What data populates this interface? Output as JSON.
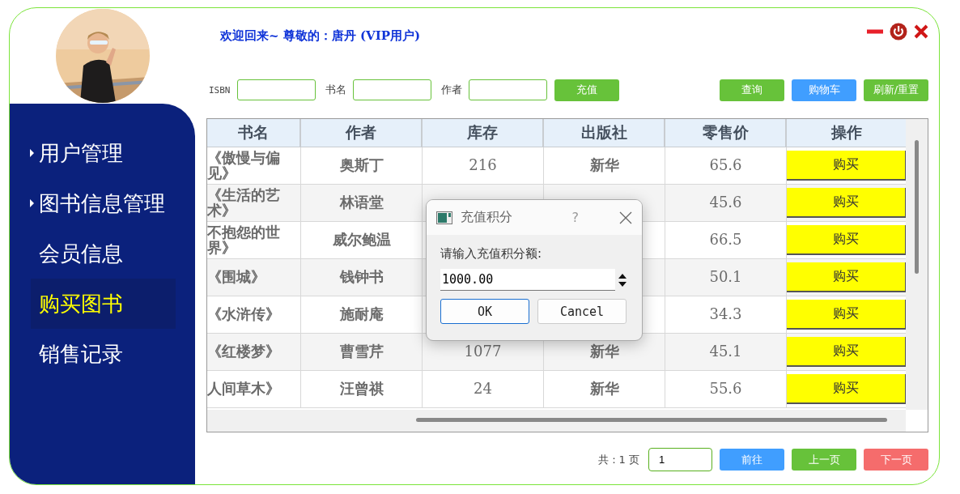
{
  "welcome": "欢迎回来~ 尊敬的：唐丹 (VIP用户)",
  "sidebar": {
    "items": [
      {
        "label": "用户管理",
        "kind": "group",
        "selected": false
      },
      {
        "label": "图书信息管理",
        "kind": "group",
        "selected": false
      },
      {
        "label": "会员信息",
        "kind": "item",
        "selected": false
      },
      {
        "label": "购买图书",
        "kind": "item",
        "selected": true
      },
      {
        "label": "销售记录",
        "kind": "item",
        "selected": false
      }
    ]
  },
  "search": {
    "fields": [
      {
        "label": "ISBN"
      },
      {
        "label": "书名"
      },
      {
        "label": "作者"
      }
    ],
    "buttons": [
      {
        "label": "充值",
        "color": "#67c23a"
      },
      {
        "label": "查询",
        "color": "#67c23a"
      },
      {
        "label": "购物车",
        "color": "#409eff"
      },
      {
        "label": "刷新/重置",
        "color": "#67c23a"
      }
    ]
  },
  "table": {
    "columns": [
      "书名",
      "作者",
      "库存",
      "出版社",
      "零售价",
      "操作"
    ],
    "rows": [
      {
        "title": "《傲慢与偏见》",
        "author": "奥斯丁",
        "stock": "216",
        "publisher": "新华",
        "price": "65.6",
        "action": "购买"
      },
      {
        "title": "《生活的艺术》",
        "author": "林语堂",
        "price": "45.6",
        "action": "购买"
      },
      {
        "title": "不抱怨的世界》",
        "author": "威尔鲍温",
        "price": "66.5",
        "action": "购买"
      },
      {
        "title": "《围城》",
        "author": "钱钟书",
        "price": "50.1",
        "action": "购买"
      },
      {
        "title": "《水浒传》",
        "author": "施耐庵",
        "price": "34.3",
        "action": "购买"
      },
      {
        "title": "《红楼梦》",
        "author": "曹雪芹",
        "stock": "1077",
        "publisher": "新华",
        "price": "45.1",
        "action": "购买"
      },
      {
        "title": "人间草木》",
        "author": "汪曾祺",
        "stock": "24",
        "publisher": "新华",
        "price": "55.6",
        "action": "购买"
      }
    ]
  },
  "dialog": {
    "title": "充值积分",
    "help": "?",
    "prompt": "请输入充值积分额:",
    "value": "1000.00",
    "buttons": [
      "OK",
      "Cancel"
    ]
  },
  "pagination": {
    "total": "共：1 页",
    "page": "1",
    "buttons": [
      {
        "label": "前往",
        "color": "#409eff"
      },
      {
        "label": "上一页",
        "color": "#67c23a"
      },
      {
        "label": "下一页",
        "color": "#f56c6c"
      }
    ]
  }
}
